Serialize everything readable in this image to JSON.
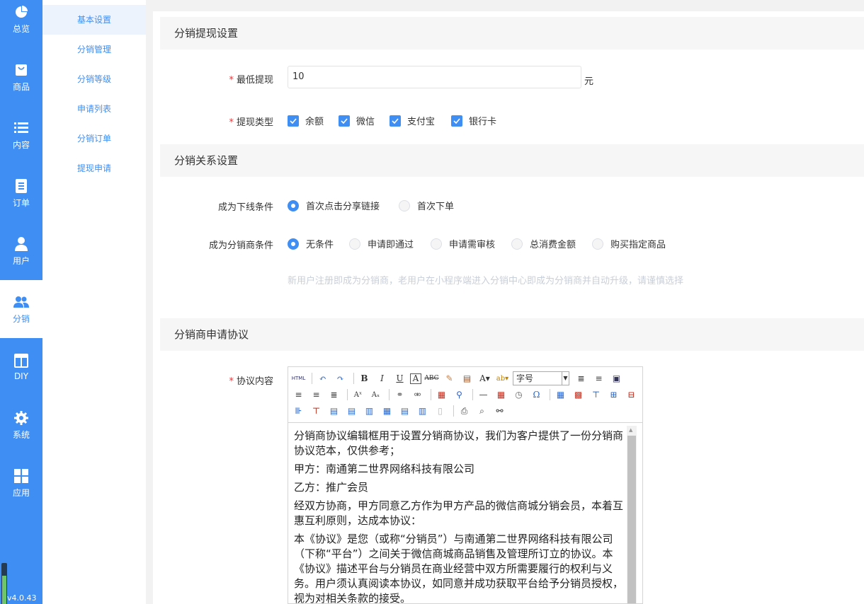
{
  "nav": {
    "items": [
      {
        "label": "总览",
        "icon": "pie-chart-icon"
      },
      {
        "label": "商品",
        "icon": "shopping-bag-icon"
      },
      {
        "label": "内容",
        "icon": "list-icon"
      },
      {
        "label": "订单",
        "icon": "document-icon"
      },
      {
        "label": "用户",
        "icon": "user-icon"
      },
      {
        "label": "分销",
        "icon": "users-icon"
      },
      {
        "label": "DIY",
        "icon": "layout-icon"
      },
      {
        "label": "系统",
        "icon": "gear-icon"
      },
      {
        "label": "应用",
        "icon": "apps-grid-icon"
      }
    ],
    "active_index": 5,
    "accent": "#3f8ef3",
    "version": "v4.0.43"
  },
  "subnav": {
    "items": [
      "基本设置",
      "分销管理",
      "分销等级",
      "申请列表",
      "分销订单",
      "提现申请"
    ],
    "active_index": 0
  },
  "withdraw": {
    "title": "分销提现设置",
    "min_label": "最低提现",
    "min_value": "10",
    "min_unit": "元",
    "type_label": "提现类型",
    "types": [
      {
        "label": "余额",
        "checked": true
      },
      {
        "label": "微信",
        "checked": true
      },
      {
        "label": "支付宝",
        "checked": true
      },
      {
        "label": "银行卡",
        "checked": true
      }
    ]
  },
  "relation": {
    "title": "分销关系设置",
    "downline_label": "成为下线条件",
    "downline_options": [
      "首次点击分享链接",
      "首次下单"
    ],
    "downline_selected": 0,
    "distributor_label": "成为分销商条件",
    "distributor_options": [
      "无条件",
      "申请即通过",
      "申请需审核",
      "总消费金额",
      "购买指定商品"
    ],
    "distributor_selected": 0,
    "hint": "新用户注册即成为分销商，老用户在小程序端进入分销中心即成为分销商并自动升级，请谨慎选择"
  },
  "agreement": {
    "title": "分销商申请协议",
    "content_label": "协议内容",
    "font_size_placeholder": "字号",
    "paragraphs": [
      "分销商协议编辑框用于设置分销商协议，我们为客户提供了一份分销商协议范本，仅供参考；",
      "甲方：南通第二世界网络科技有限公司",
      "乙方：推广会员",
      "经双方协商，甲方同意乙方作为甲方产品的微信商城分销会员，本着互惠互利原则，达成本协议：",
      "本《协议》是您（或称“分销员”）与南通第二世界网络科技有限公司（下称“平台”）之间关于微信商城商品销售及管理所订立的协议。本《协议》描述平台与分销员在商业经营中双方所需要履行的权利与义务。用户须认真阅读本协议，如同意并成功获取平台给予分销员授权，视为对相关条款的接受。"
    ]
  }
}
